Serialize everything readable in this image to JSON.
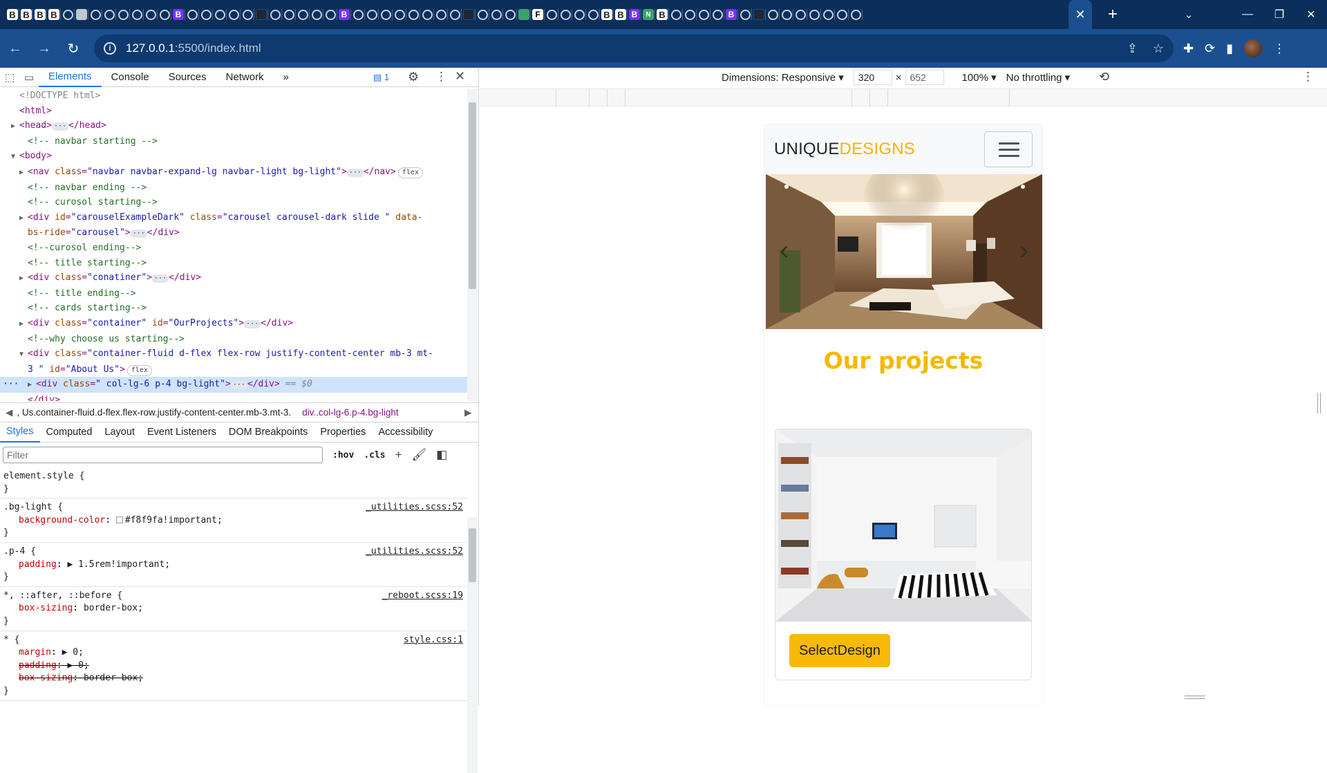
{
  "browser": {
    "tabs": [
      {
        "icon": "b-icon",
        "glyph": "B",
        "style": "b"
      },
      {
        "icon": "b-icon",
        "glyph": "B",
        "style": "b"
      },
      {
        "icon": "b-icon",
        "glyph": "B",
        "style": "b"
      },
      {
        "icon": "b-icon",
        "glyph": "B",
        "style": "b"
      },
      {
        "icon": "globe-icon",
        "glyph": "",
        "style": "g"
      },
      {
        "icon": "image-icon",
        "glyph": "",
        "style": "img"
      },
      {
        "icon": "globe-icon",
        "glyph": "",
        "style": "g"
      },
      {
        "icon": "globe-icon",
        "glyph": "",
        "style": "g"
      },
      {
        "icon": "globe-icon",
        "glyph": "",
        "style": "g"
      },
      {
        "icon": "globe-icon",
        "glyph": "",
        "style": "g"
      },
      {
        "icon": "globe-icon",
        "glyph": "",
        "style": "g"
      },
      {
        "icon": "globe-icon",
        "glyph": "",
        "style": "g"
      },
      {
        "icon": "bootstrap-icon",
        "glyph": "B",
        "style": "bp"
      },
      {
        "icon": "globe-icon",
        "glyph": "",
        "style": "g"
      },
      {
        "icon": "globe-icon",
        "glyph": "",
        "style": "g"
      },
      {
        "icon": "globe-icon",
        "glyph": "",
        "style": "g"
      },
      {
        "icon": "globe-icon",
        "glyph": "",
        "style": "g"
      },
      {
        "icon": "globe-icon",
        "glyph": "",
        "style": "g"
      },
      {
        "icon": "dark-tab-icon",
        "glyph": "",
        "style": "dark"
      },
      {
        "icon": "globe-icon",
        "glyph": "",
        "style": "g"
      },
      {
        "icon": "globe-icon",
        "glyph": "",
        "style": "g"
      },
      {
        "icon": "globe-icon",
        "glyph": "",
        "style": "g"
      },
      {
        "icon": "globe-icon",
        "glyph": "",
        "style": "g"
      },
      {
        "icon": "globe-icon",
        "glyph": "",
        "style": "g"
      },
      {
        "icon": "bootstrap-icon",
        "glyph": "B",
        "style": "bp"
      },
      {
        "icon": "globe-icon",
        "glyph": "",
        "style": "g"
      },
      {
        "icon": "globe-icon",
        "glyph": "",
        "style": "g"
      },
      {
        "icon": "globe-icon",
        "glyph": "",
        "style": "g"
      },
      {
        "icon": "globe-icon",
        "glyph": "",
        "style": "g"
      },
      {
        "icon": "globe-icon",
        "glyph": "",
        "style": "g"
      },
      {
        "icon": "globe-icon",
        "glyph": "",
        "style": "g"
      },
      {
        "icon": "globe-icon",
        "glyph": "",
        "style": "g"
      },
      {
        "icon": "globe-icon",
        "glyph": "",
        "style": "g"
      },
      {
        "icon": "dark-tab-icon",
        "glyph": "",
        "style": "dark"
      },
      {
        "icon": "globe-icon",
        "glyph": "",
        "style": "g"
      },
      {
        "icon": "globe-icon",
        "glyph": "",
        "style": "g"
      },
      {
        "icon": "globe-icon",
        "glyph": "",
        "style": "g"
      },
      {
        "icon": "spiral-icon",
        "glyph": "",
        "style": "grn"
      },
      {
        "icon": "f-icon",
        "glyph": "F",
        "style": "wt"
      },
      {
        "icon": "globe-icon",
        "glyph": "",
        "style": "g"
      },
      {
        "icon": "globe-icon",
        "glyph": "",
        "style": "g"
      },
      {
        "icon": "globe-icon",
        "glyph": "",
        "style": "g"
      },
      {
        "icon": "globe-icon",
        "glyph": "",
        "style": "g"
      },
      {
        "icon": "b-icon",
        "glyph": "B",
        "style": "b"
      },
      {
        "icon": "b-icon",
        "glyph": "B",
        "style": "b"
      },
      {
        "icon": "bootstrap-icon",
        "glyph": "B",
        "style": "bp"
      },
      {
        "icon": "n-icon",
        "glyph": "N",
        "style": "grn"
      },
      {
        "icon": "b-icon",
        "glyph": "B",
        "style": "b"
      },
      {
        "icon": "globe-icon",
        "glyph": "",
        "style": "g"
      },
      {
        "icon": "globe-icon",
        "glyph": "",
        "style": "g"
      },
      {
        "icon": "globe-icon",
        "glyph": "",
        "style": "g"
      },
      {
        "icon": "globe-icon",
        "glyph": "",
        "style": "g"
      },
      {
        "icon": "bootstrap-icon",
        "glyph": "B",
        "style": "bp"
      },
      {
        "icon": "globe-icon",
        "glyph": "",
        "style": "g"
      },
      {
        "icon": "dark-tab-icon",
        "glyph": "",
        "style": "dark"
      },
      {
        "icon": "globe-icon",
        "glyph": "",
        "style": "g"
      },
      {
        "icon": "globe-icon",
        "glyph": "",
        "style": "g"
      },
      {
        "icon": "globe-icon",
        "glyph": "",
        "style": "g"
      },
      {
        "icon": "globe-icon",
        "glyph": "",
        "style": "g"
      },
      {
        "icon": "globe-icon",
        "glyph": "",
        "style": "g"
      },
      {
        "icon": "globe-icon",
        "glyph": "",
        "style": "g"
      },
      {
        "icon": "globe-icon",
        "glyph": "",
        "style": "g"
      }
    ],
    "address_host": "127.0.0.1",
    "address_path": ":5500/index.html",
    "accent_color": "#1b4f8f",
    "tabstrip_color": "#0b2e5a"
  },
  "devtools": {
    "tabs": [
      "Elements",
      "Console",
      "Sources",
      "Network"
    ],
    "more": "»",
    "message_count": "1",
    "dom_lines": [
      {
        "indent": 0,
        "tri": "",
        "html": "<span class='dim'>&lt;!DOCTYPE html&gt;</span>"
      },
      {
        "indent": 0,
        "tri": "",
        "html": "<span class='tg'>&lt;html&gt;</span>"
      },
      {
        "indent": 0,
        "tri": "▶",
        "html": "<span class='tg'>&lt;head&gt;</span><span class='ell'>···</span><span class='tg'>&lt;/head&gt;</span>"
      },
      {
        "indent": 1,
        "tri": "",
        "html": "<span class='cm'>&lt;!-- navbar starting --&gt;</span>"
      },
      {
        "indent": 0,
        "tri": "▼",
        "html": "<span class='tg'>&lt;body&gt;</span>"
      },
      {
        "indent": 1,
        "tri": "▶",
        "html": "<span class='tg'>&lt;nav </span><span class='an'>class</span><span class='tg'>=</span><span class='av'>\"navbar navbar-expand-lg navbar-light bg-light\"</span><span class='tg'>&gt;</span><span class='ell'>···</span><span class='tg'>&lt;/nav&gt;</span><span class='pill'>flex</span>"
      },
      {
        "indent": 1,
        "tri": "",
        "html": "<span class='cm'>&lt;!-- navbar ending --&gt;</span>"
      },
      {
        "indent": 1,
        "tri": "",
        "html": "<span class='cm'>&lt;!-- curosol starting--&gt;</span>"
      },
      {
        "indent": 1,
        "tri": "▶",
        "html": "<span class='tg'>&lt;div </span><span class='an'>id</span><span class='tg'>=</span><span class='av'>\"carouselExampleDark\"</span> <span class='an'>class</span><span class='tg'>=</span><span class='av'>\"carousel carousel-dark slide \"</span> <span class='an'>data-</span>"
      },
      {
        "indent": 1,
        "tri": "",
        "html": "<span class='an'>bs-ride</span><span class='tg'>=</span><span class='av'>\"carousel\"</span><span class='tg'>&gt;</span><span class='ell'>···</span><span class='tg'>&lt;/div&gt;</span>"
      },
      {
        "indent": 1,
        "tri": "",
        "html": "<span class='cm'>&lt;!--curosol ending--&gt;</span>"
      },
      {
        "indent": 1,
        "tri": "",
        "html": "<span class='cm'>&lt;!-- title  starting--&gt;</span>"
      },
      {
        "indent": 1,
        "tri": "▶",
        "html": "<span class='tg'>&lt;div </span><span class='an'>class</span><span class='tg'>=</span><span class='av'>\"conatiner\"</span><span class='tg'>&gt;</span><span class='ell'>···</span><span class='tg'>&lt;/div&gt;</span>"
      },
      {
        "indent": 1,
        "tri": "",
        "html": "<span class='cm'>&lt;!-- title  ending--&gt;</span>"
      },
      {
        "indent": 1,
        "tri": "",
        "html": "<span class='cm'>&lt;!-- cards  starting--&gt;</span>"
      },
      {
        "indent": 1,
        "tri": "▶",
        "html": "<span class='tg'>&lt;div </span><span class='an'>class</span><span class='tg'>=</span><span class='av'>\"container\"</span> <span class='an'>id</span><span class='tg'>=</span><span class='av'>\"OurProjects\"</span><span class='tg'>&gt;</span><span class='ell'>···</span><span class='tg'>&lt;/div&gt;</span>"
      },
      {
        "indent": 1,
        "tri": "",
        "html": "<span class='cm'>&lt;!--why choose us starting--&gt;</span>"
      },
      {
        "indent": 1,
        "tri": "▼",
        "html": "<span class='tg'>&lt;div </span><span class='an'>class</span><span class='tg'>=</span><span class='av'>\"container-fluid d-flex flex-row justify-content-center mb-3 mt-</span>"
      },
      {
        "indent": 1,
        "tri": "",
        "html": "<span class='av'>3 \"</span> <span class='an'>id</span><span class='tg'>=</span><span class='av'>\"About Us\"</span><span class='tg'>&gt;</span><span class='pill'>flex</span>"
      },
      {
        "indent": 2,
        "tri": "▶",
        "html": "<span class='tg'>&lt;div </span><span class='an'>class</span><span class='tg'>=</span><span class='av'>\"  col-lg-6 p-4 bg-light\"</span><span class='tg'>&gt;</span><span class='ell'>···</span><span class='tg'>&lt;/div&gt;</span> <span class='dim'><i>== $0</i></span>",
        "selected": true
      },
      {
        "indent": 1,
        "tri": "",
        "html": "<span class='tg'>&lt;/div&gt;</span>"
      }
    ],
    "breadcrumb_1": ", Us.container-fluid.d-flex.flex-row.justify-content-center.mb-3.mt-3.",
    "breadcrumb_2": "div..col-lg-6.p-4.bg-light",
    "subtabs": [
      "Styles",
      "Computed",
      "Layout",
      "Event Listeners",
      "DOM Breakpoints",
      "Properties",
      "Accessibility"
    ],
    "filter_placeholder": "Filter",
    "hov": ":hov",
    "cls": ".cls",
    "rules": [
      {
        "selector": "element.style {",
        "source": "",
        "decls": []
      },
      {
        "selector": ".bg-light {",
        "source": "_utilities.scss:52",
        "decls": [
          {
            "p": "background-color",
            "v": "#f8f9fa!important;",
            "swatch": true
          }
        ]
      },
      {
        "selector": ".p-4 {",
        "source": "_utilities.scss:52",
        "decls": [
          {
            "p": "padding",
            "v": "▶ 1.5rem!important;"
          }
        ]
      },
      {
        "selector": "*, ::after, ::before {",
        "source": "_reboot.scss:19",
        "decls": [
          {
            "p": "box-sizing",
            "v": "border-box;"
          }
        ]
      },
      {
        "selector": "* {",
        "source": "style.css:1",
        "decls": [
          {
            "p": "margin",
            "v": "▶ 0;"
          },
          {
            "p": "padding",
            "v": "▶ 0;",
            "strike": true
          },
          {
            "p": "box-sizing",
            "v": "border-box;",
            "strike": true
          }
        ]
      }
    ]
  },
  "device_toolbar": {
    "dimensions_label": "Dimensions: Responsive",
    "width": "320",
    "times": "×",
    "height": "652",
    "zoom": "100%",
    "throttling": "No throttling"
  },
  "site": {
    "brand_1": "UNIQUE",
    "brand_2": "DESIGNS",
    "projects_title": "Our projects",
    "select_button": "SelectDesign",
    "accent_color": "#f5b800"
  }
}
